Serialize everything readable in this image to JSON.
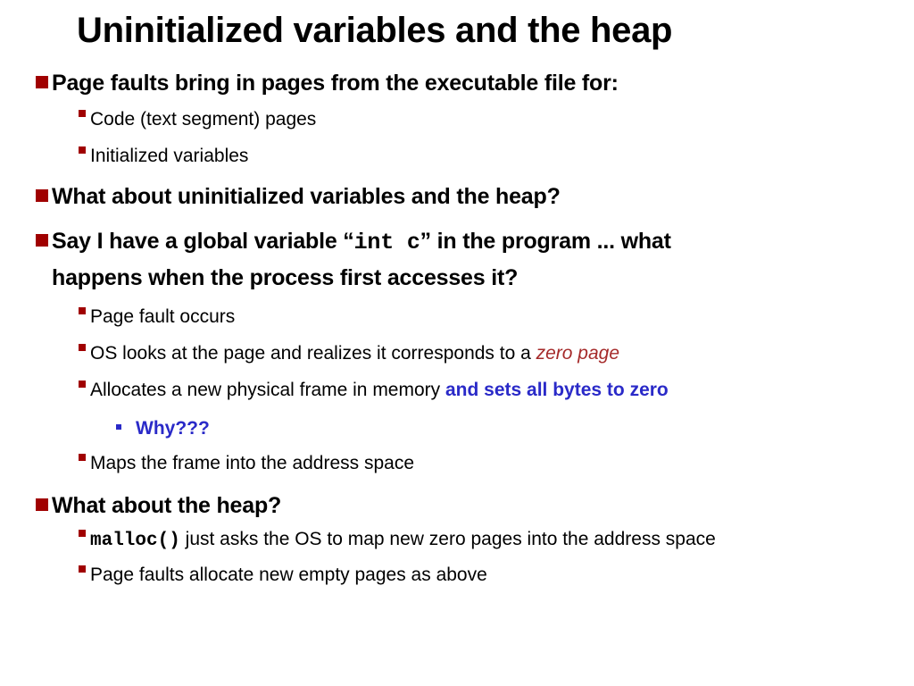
{
  "slide": {
    "title": "Uninitialized variables and the heap",
    "accent_colors": {
      "bullet": "#a00000",
      "highlight_red": "#a52a2a",
      "highlight_blue": "#2a2ac8"
    },
    "bullets": [
      {
        "text": "Page faults bring in pages from the executable file for:",
        "children": [
          {
            "text": "Code (text segment) pages"
          },
          {
            "text": "Initialized variables"
          }
        ]
      },
      {
        "text": "What about uninitialized variables and the heap?"
      },
      {
        "text_before": "Say I have a global variable “",
        "code": "int c",
        "text_after": "” in the program ... what",
        "text_line2": "happens when the process first accesses it?",
        "children": [
          {
            "text": "Page fault occurs"
          },
          {
            "text": "OS looks at the page and realizes it corresponds to a ",
            "emphasis": "zero page"
          },
          {
            "text": "Allocates a new physical frame in memory ",
            "emphasis": "and sets all bytes to zero",
            "children": [
              {
                "text": "Why???"
              }
            ]
          },
          {
            "text": "Maps the frame into the address space"
          }
        ]
      },
      {
        "text": "What about the heap?",
        "children": [
          {
            "code": "malloc()",
            "text": " just asks the OS to map new zero pages into the address space"
          },
          {
            "text": "Page faults allocate new empty pages as above"
          }
        ]
      }
    ]
  }
}
